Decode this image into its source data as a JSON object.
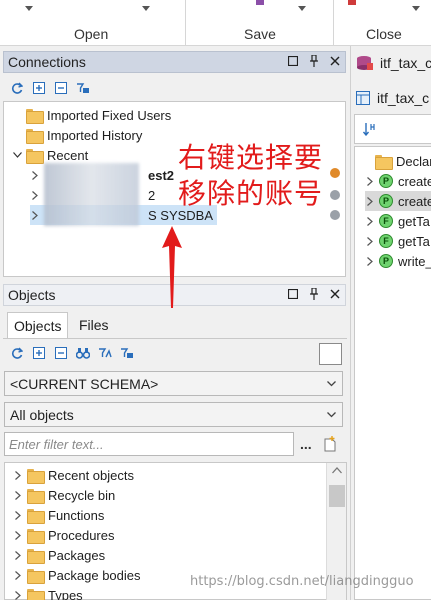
{
  "toolbar": {
    "groups": [
      {
        "label": "Open"
      },
      {
        "label": "Save"
      },
      {
        "label": "Close"
      }
    ]
  },
  "connections": {
    "title": "Connections",
    "tree": {
      "items": [
        {
          "label": "Imported Fixed Users"
        },
        {
          "label": "Imported History"
        },
        {
          "label": "Recent"
        }
      ],
      "recent_children": [
        {
          "label": "est2"
        },
        {
          "label": "2"
        },
        {
          "label": "S SYSDBA"
        }
      ]
    }
  },
  "objects": {
    "title": "Objects",
    "tabs": [
      {
        "label": "Objects"
      },
      {
        "label": "Files"
      }
    ],
    "schema_select": "<CURRENT SCHEMA>",
    "type_select": "All objects",
    "filter_placeholder": "Enter filter text...",
    "more_label": "...",
    "items": [
      {
        "label": "Recent objects"
      },
      {
        "label": "Recycle bin"
      },
      {
        "label": "Functions"
      },
      {
        "label": "Procedures"
      },
      {
        "label": "Packages"
      },
      {
        "label": "Package bodies"
      },
      {
        "label": "Types"
      }
    ]
  },
  "editor": {
    "tabs": [
      {
        "label": "itf_tax_c"
      },
      {
        "label": "itf_tax_c"
      }
    ],
    "items": [
      {
        "label": "Declar",
        "kind": "folder"
      },
      {
        "label": "create",
        "kind": "P"
      },
      {
        "label": "create",
        "kind": "P"
      },
      {
        "label": "getTa",
        "kind": "F"
      },
      {
        "label": "getTa",
        "kind": "F"
      },
      {
        "label": "write_",
        "kind": "P"
      }
    ]
  },
  "annotation": {
    "line1": "右键选择要",
    "line2": "移除的账号"
  },
  "watermark": "https://blog.csdn.net/liangdingguo",
  "colors": {
    "panel_header": "#cfd6e3",
    "annotation": "#e21b1b",
    "selection": "#cde3f7"
  }
}
